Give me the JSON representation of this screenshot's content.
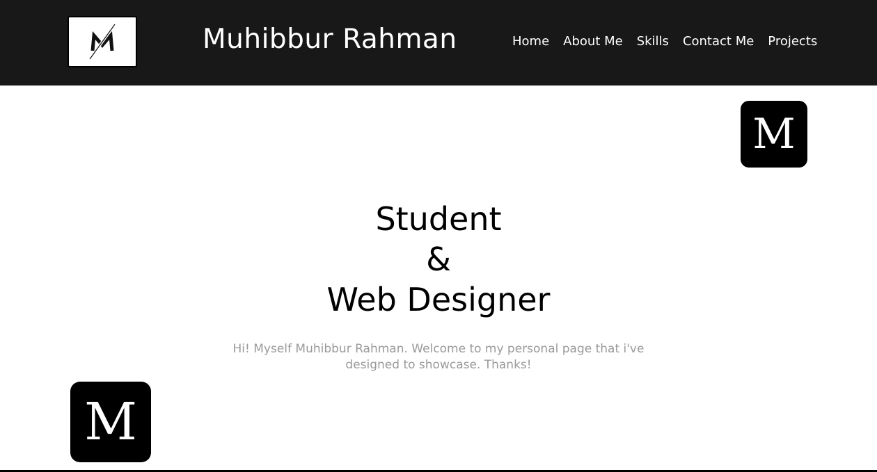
{
  "header": {
    "logo_icon": "slashed-m-logo-icon",
    "brand_name": "Muhibbur Rahman",
    "nav": [
      {
        "label": "Home"
      },
      {
        "label": "About Me"
      },
      {
        "label": "Skills"
      },
      {
        "label": "Contact Me"
      },
      {
        "label": "Projects"
      }
    ]
  },
  "hero": {
    "line1": "Student",
    "line2": "&",
    "line3": "Web Designer",
    "intro": "Hi! Myself Muhibbur Rahman. Welcome to my personal page that i've designed to showcase. Thanks!"
  },
  "decor": {
    "badge_top_letter": "M",
    "badge_bottom_letter": "M"
  },
  "colors": {
    "header_bg": "#181818",
    "intro_text": "#9a9a9a"
  }
}
